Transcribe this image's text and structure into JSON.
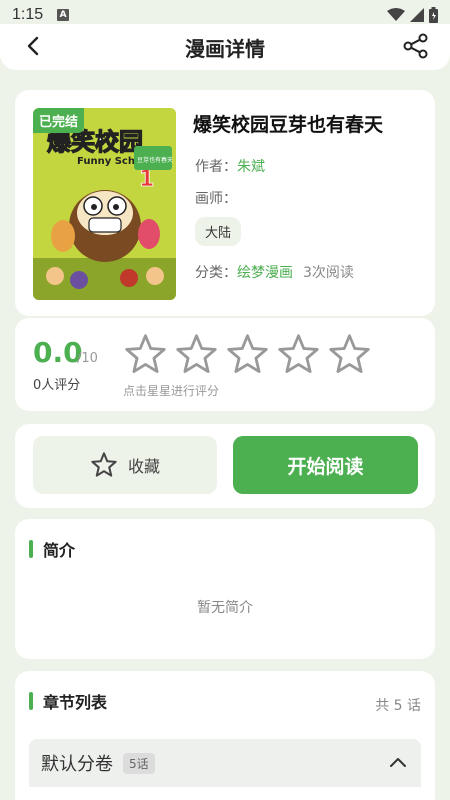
{
  "status_bar": {
    "time": "1:15",
    "notification": "A"
  },
  "header": {
    "title": "漫画详情"
  },
  "comic": {
    "cover_badge": "已完结",
    "title": "爆笑校园豆芽也有春天",
    "author_label": "作者：",
    "author": "朱斌",
    "artist_label": "画师：",
    "artist": "",
    "region_tag": "大陆",
    "category_label": "分类：",
    "category": "绘梦漫画",
    "reads": "3次阅读",
    "cover_art": {
      "title_text": "爆笑校园",
      "subtitle_text": "Funny School",
      "side_text": "豆芽也有春天",
      "volume_number": "1"
    }
  },
  "rating": {
    "score": "0.0",
    "max": "/10",
    "raters": "0人评分",
    "hint": "点击星星进行评分",
    "stars_selected": 0,
    "stars_total": 5
  },
  "actions": {
    "favorite_label": "收藏",
    "read_label": "开始阅读"
  },
  "intro": {
    "heading": "简介",
    "empty_text": "暂无简介"
  },
  "chapters": {
    "heading": "章节列表",
    "count_text": "共 5 话",
    "volumes": [
      {
        "name": "默认分卷",
        "badge": "5话"
      }
    ]
  },
  "colors": {
    "accent": "#4caf50",
    "background": "#eef3ea"
  }
}
